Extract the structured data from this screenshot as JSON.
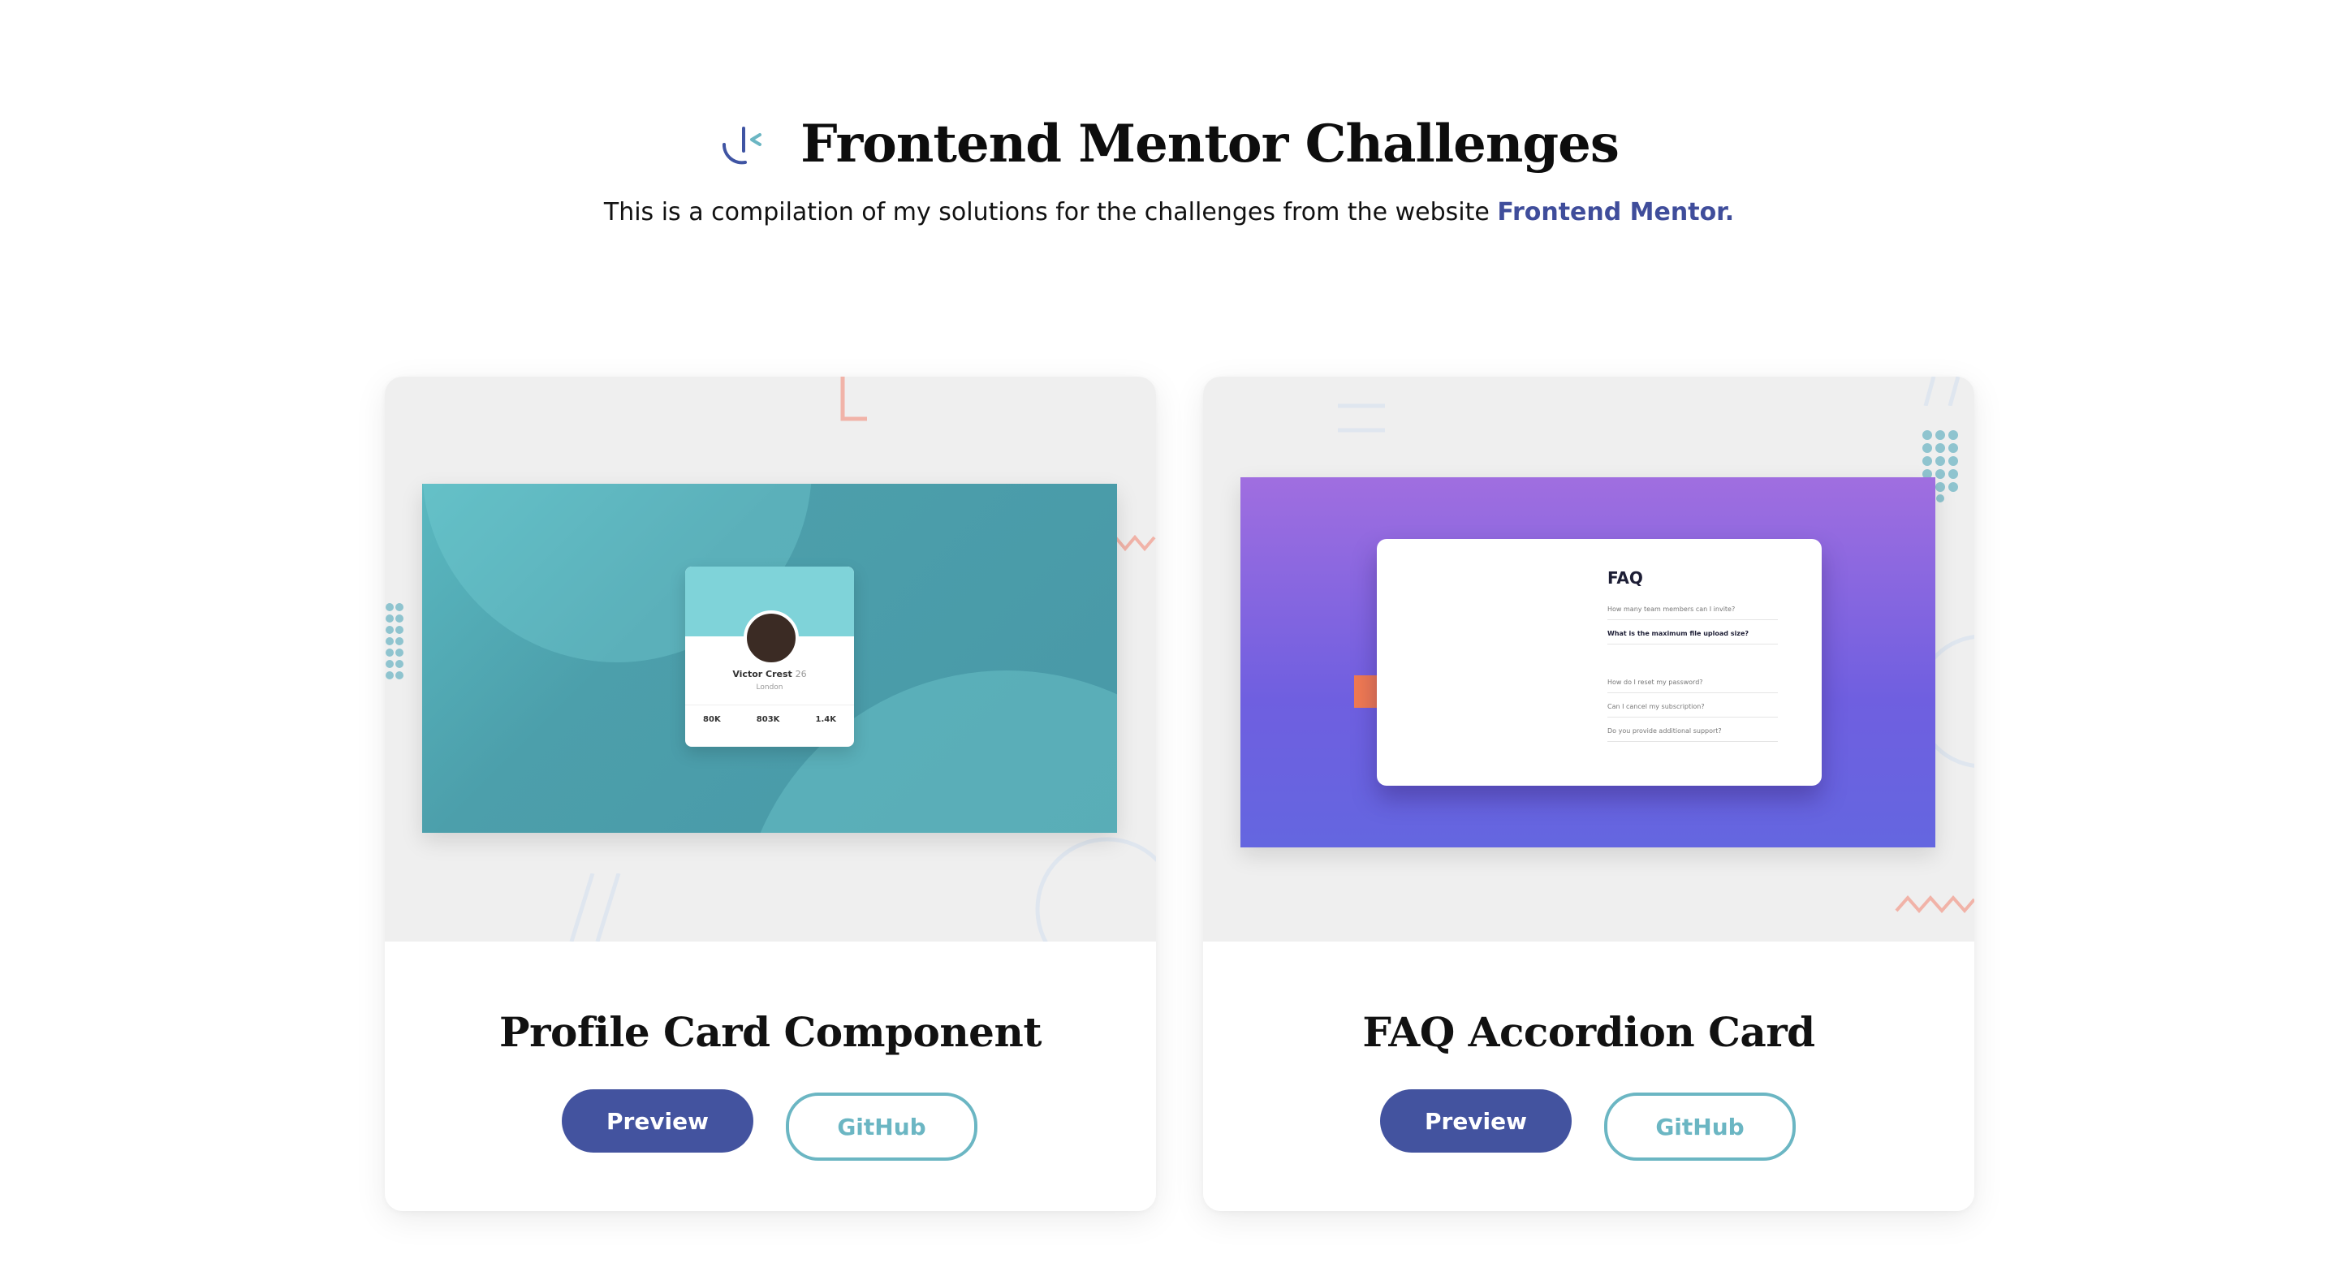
{
  "header": {
    "logo_icon": "frontend-mentor-logo-icon",
    "title": "Frontend Mentor Challenges",
    "subtitle_prefix": "This is a compilation of my solutions for the challenges from the website ",
    "subtitle_link": "Frontend Mentor."
  },
  "colors": {
    "primary_button": "#43539f",
    "github_outline": "#6bb6c3",
    "link": "#3f4d9b",
    "thumb_background": "#efefef"
  },
  "cards": [
    {
      "title": "Profile Card Component",
      "preview_label": "Preview",
      "github_label": "GitHub",
      "thumbnail": {
        "name": "Victor Crest",
        "age": "26",
        "location": "London",
        "stats": [
          "80K",
          "803K",
          "1.4K"
        ]
      }
    },
    {
      "title": "FAQ Accordion Card",
      "preview_label": "Preview",
      "github_label": "GitHub",
      "thumbnail": {
        "heading": "FAQ",
        "questions": [
          "How many team members can I invite?",
          "What is the maximum file upload size?",
          "How do I reset my password?",
          "Can I cancel my subscription?",
          "Do you provide additional support?"
        ]
      }
    }
  ]
}
